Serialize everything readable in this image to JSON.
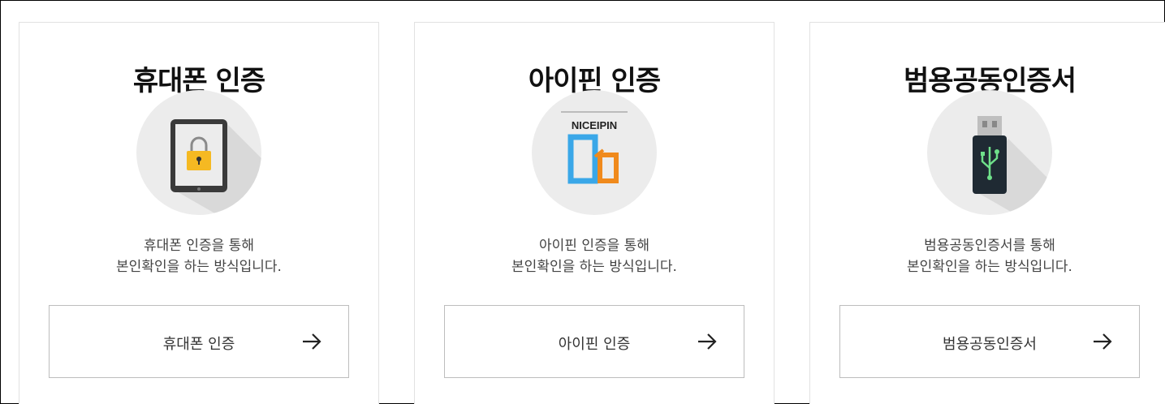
{
  "cards": [
    {
      "title": "휴대폰 인증",
      "icon": "mobile-lock-icon",
      "desc_line1": "휴대폰 인증을 통해",
      "desc_line2": "본인확인을 하는 방식입니다.",
      "button_label": "휴대폰 인증"
    },
    {
      "title": "아이핀 인증",
      "icon": "nice-ipin-icon",
      "logo_text": "NICEIPIN",
      "desc_line1": "아이핀 인증을 통해",
      "desc_line2": "본인확인을 하는 방식입니다.",
      "button_label": "아이핀 인증"
    },
    {
      "title": "범용공동인증서",
      "icon": "usb-certificate-icon",
      "desc_line1": "범용공동인증서를 통해",
      "desc_line2": "본인확인을 하는 방식입니다.",
      "button_label": "범용공동인증서"
    }
  ],
  "colors": {
    "lock_yellow": "#f5b922",
    "ipin_blue": "#3aa7e8",
    "ipin_orange": "#f08a1c",
    "usb_green": "#6fe08a"
  }
}
